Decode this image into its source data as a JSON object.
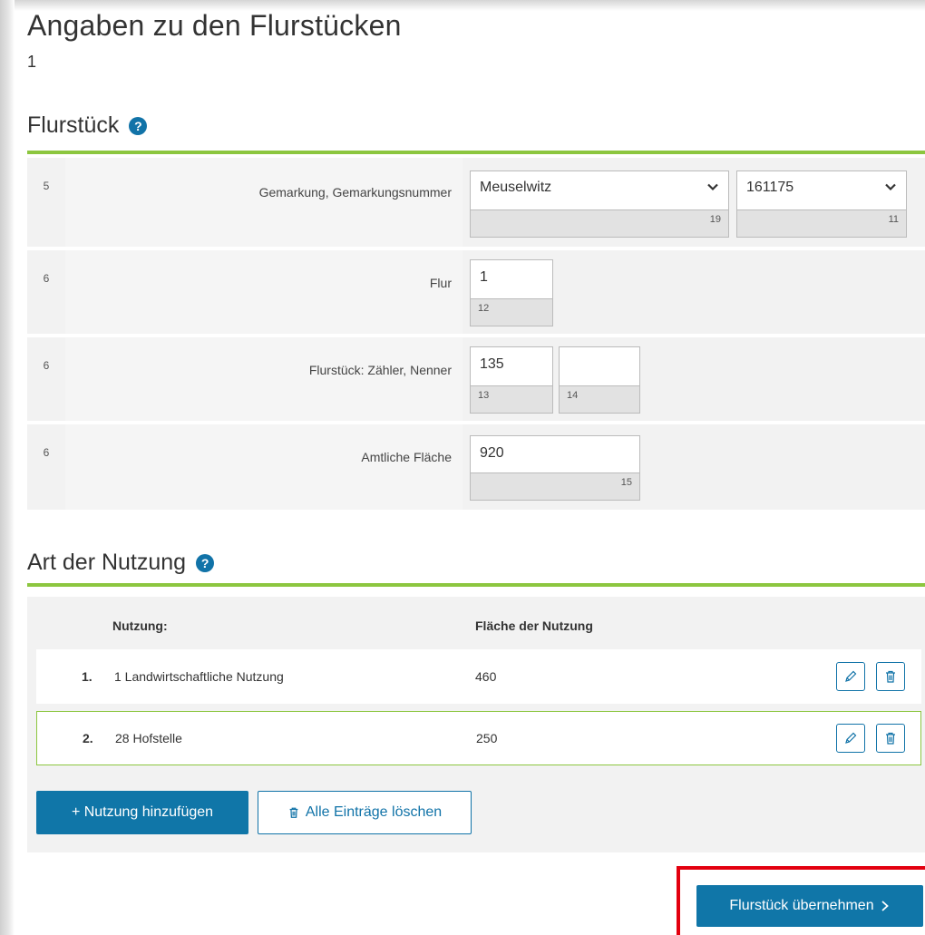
{
  "page": {
    "title": "Angaben zu den Flurstücken",
    "subtitle": "1"
  },
  "flurstueck": {
    "heading": "Flurstück",
    "help_icon": "?",
    "rows": [
      {
        "num": "5",
        "label": "Gemarkung,  Gemarkungsnummer",
        "fields": [
          {
            "value": "Meuselwitz",
            "code": "19",
            "type": "select"
          },
          {
            "value": "161175",
            "code": "11",
            "type": "select"
          }
        ]
      },
      {
        "num": "6",
        "label": "Flur",
        "fields": [
          {
            "value": "1",
            "code": "12",
            "type": "text"
          }
        ]
      },
      {
        "num": "6",
        "label": "Flurstück: Zähler,  Nenner",
        "fields": [
          {
            "value": "135",
            "code": "13",
            "type": "text"
          },
          {
            "value": "",
            "code": "14",
            "type": "text"
          }
        ]
      },
      {
        "num": "6",
        "label": "Amtliche Fläche",
        "fields": [
          {
            "value": "920",
            "code": "15",
            "type": "text"
          }
        ]
      }
    ]
  },
  "nutzung": {
    "heading": "Art der Nutzung",
    "help_icon": "?",
    "columns": {
      "nutzung": "Nutzung:",
      "flaeche": "Fläche der Nutzung"
    },
    "entries": [
      {
        "num": "1.",
        "name": "1 Landwirtschaftliche Nutzung",
        "area": "460"
      },
      {
        "num": "2.",
        "name": "28 Hofstelle",
        "area": "250"
      }
    ],
    "add_button": "+ Nutzung hinzufügen",
    "delete_all_button": "Alle Einträge löschen"
  },
  "footer": {
    "submit_button": "Flurstück übernehmen"
  },
  "colors": {
    "accent_green": "#8cc63f",
    "primary_blue": "#1076a8",
    "highlight_red": "#e3000f"
  },
  "icons": [
    "help-icon",
    "chevron-down-icon",
    "pencil-icon",
    "trash-icon",
    "chevron-right-icon"
  ]
}
